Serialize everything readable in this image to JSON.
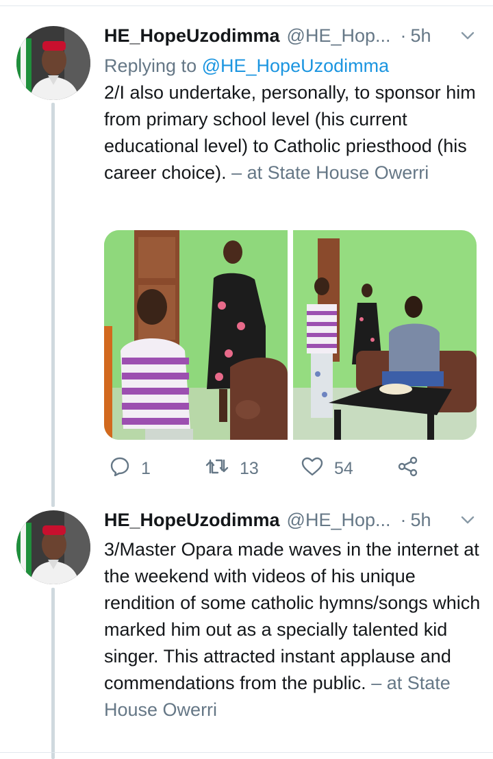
{
  "tweets": [
    {
      "name": "HE_HopeUzodimma",
      "handle": "@HE_Hop...",
      "dot": "·",
      "time": "5h",
      "reply_prefix": "Replying to",
      "reply_mention": "@HE_HopeUzodimma",
      "text": "2/I also undertake, personally, to sponsor him from primary school level (his current educational level) to Catholic priesthood (his career choice).",
      "location": "– at State House Owerri",
      "replies": "1",
      "retweets": "13",
      "likes": "54"
    },
    {
      "name": "HE_HopeUzodimma",
      "handle": "@HE_Hop...",
      "dot": "·",
      "time": "5h",
      "text": "3/Master Opara made waves in the internet at the weekend with videos of his unique rendition of some catholic hymns/songs which marked him out as a specially talented kid singer. This attracted instant applause  and commendations from the public.",
      "location": "– at State House Owerri"
    }
  ],
  "icons": {
    "reply": "reply-icon",
    "retweet": "retweet-icon",
    "like": "heart-icon",
    "share": "share-icon",
    "caret": "chevron-down-icon"
  },
  "colors": {
    "link": "#1b95e0",
    "secondary": "#657786",
    "thread_line": "#cfd9de"
  }
}
